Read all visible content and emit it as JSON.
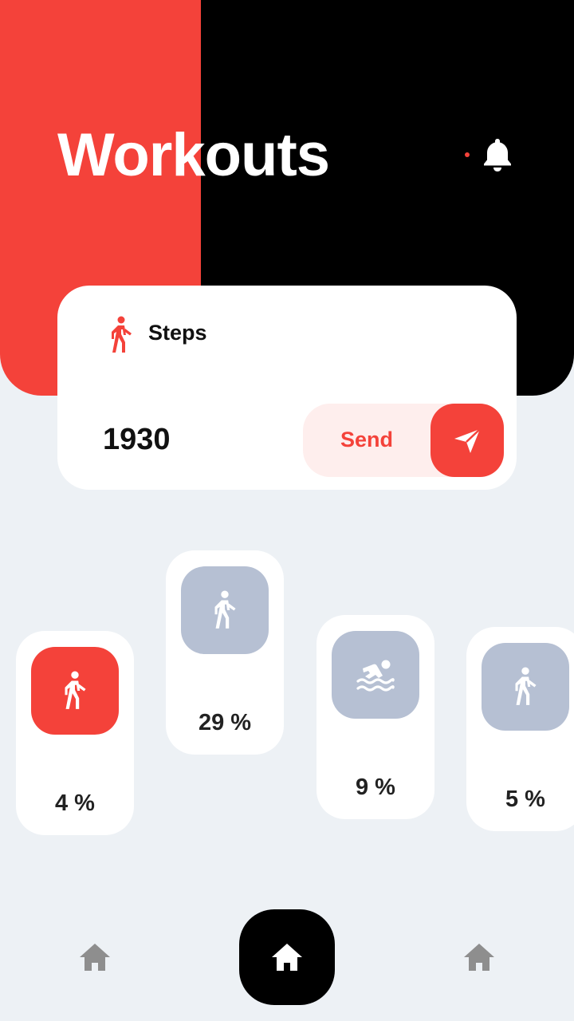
{
  "header": {
    "title": "Workouts"
  },
  "icons": {
    "notifications": "bell-icon",
    "steps": "walking-icon",
    "send": "send-icon",
    "home": "home-icon"
  },
  "colors": {
    "accent": "#f4423a",
    "dark": "#000000",
    "inactive_tile": "#b6c0d3",
    "background": "#edf1f5"
  },
  "steps_card": {
    "label": "Steps",
    "value": "1930",
    "send_label": "Send"
  },
  "activities": [
    {
      "icon": "walking-icon",
      "percent": "4 %",
      "selected": true
    },
    {
      "icon": "walking-icon",
      "percent": "29 %",
      "selected": false
    },
    {
      "icon": "swimming-icon",
      "percent": "9 %",
      "selected": false
    },
    {
      "icon": "walking-icon",
      "percent": "5 %",
      "selected": false
    }
  ],
  "nav": {
    "items": [
      "home-icon",
      "home-icon",
      "home-icon"
    ],
    "active_index": 1
  }
}
